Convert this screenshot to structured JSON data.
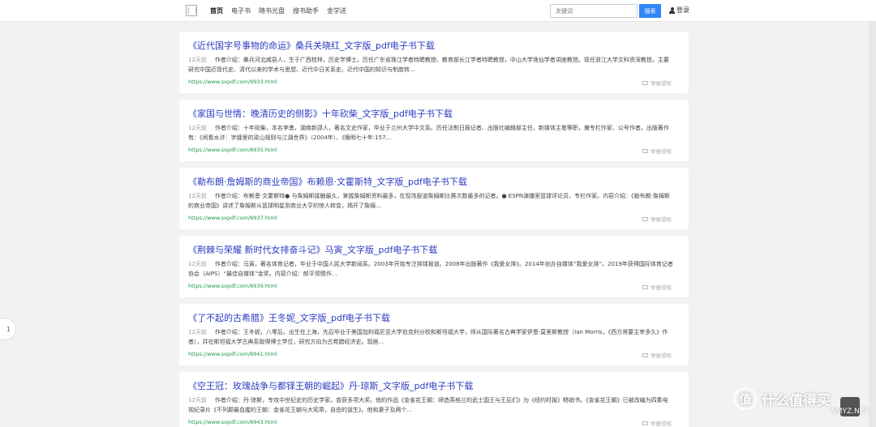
{
  "header": {
    "nav": [
      "首页",
      "电子书",
      "随书光盘",
      "搜书助手",
      "金学送"
    ],
    "search_placeholder": "关键词",
    "search_button": "搜索",
    "login": "登录"
  },
  "results": [
    {
      "title": "《近代国字号事物的命运》桑兵关晓红_文字版_pdf电子书下载",
      "time": "12天前",
      "desc": "作者介绍：桑兵河北威县人，生于广西桂林，历史学博士。历任广东省珠江学者特聘教授、教育部长江学者特聘教授，中山大学逸仙学者讲座教授。现任浙江大学文科资深教授。主要研究中国近现代史、清代以来的学术与思想、近代中日关系史、近代中国的知识与制度转...",
      "url": "https://www.sxpdf.com/8933.html",
      "report": "举报侵权"
    },
    {
      "title": "《家国与世情：晚清历史的侧影》十年砍柴_文字版_pdf电子书下载",
      "time": "12天前",
      "desc": "作者介绍：十年砍柴，本名李勇，湖南新邵人，著名文史作家，毕业于兰州大学中文系。历任法制日报记者、出版社编辑部主任、新媒体主笔等职，兼专栏作家、公号作者。出版著作有：《闲看水浒：字缝里的梁山规则与江湖世界》（2004年）、《晚明七十年:157...",
      "url": "https://www.sxpdf.com/8935.html",
      "report": "举报侵权"
    },
    {
      "title": "《勒布朗·詹姆斯的商业帝国》布赖恩·文霍斯特_文字版_pdf电子书下载",
      "time": "12天前",
      "desc": "作者介绍：布赖恩·文霍斯特● 与詹姆斯接触最久，掌握詹姆斯资料最多，在现场报道詹姆斯比赛次数最多的记者。● ESPN演播室篮球评论员、专栏作家。内容介绍：《勒布朗·詹姆斯的商业帝国》讲述了詹姆斯从篮球明星到商业大亨的惊人转变，揭开了詹姆...",
      "url": "https://www.sxpdf.com/8937.html",
      "report": "举报侵权"
    },
    {
      "title": "《荆棘与荣耀 新时代女排奋斗记》马寅_文字版_pdf电子书下载",
      "time": "12天前",
      "desc": "作者介绍：马寅，著名体育记者，毕业于中国人民大学新闻系。2003年开始专注排球报道。2008年出版著作《我爱女排》。2014年创办自媒体“我爱女排”。2019年获得国际体育记者协会（AIPS）“最佳自媒体”金奖。内容介绍：郎平领情作...",
      "url": "https://www.sxpdf.com/8939.html",
      "report": "举报侵权"
    },
    {
      "title": "《了不起的古希腊》王冬妮_文字版_pdf电子书下载",
      "time": "12天前",
      "desc": "作者介绍：王冬妮，八零后，出生在上海，先后毕业于美国加利福尼亚大学伯克利分校和斯坦福大学，师从国际著名古典学家伊恩·莫里斯教授（Ian Morris，《西方将要主宰多久》作者），并在斯坦福大学古典系取得博士学位，研究方向为古希腊经济史。现居...",
      "url": "https://www.sxpdf.com/8941.html",
      "report": "举报侵权"
    },
    {
      "title": "《空王冠：玫瑰战争与都铎王朝的崛起》丹·琼斯_文字版_pdf电子书下载",
      "time": "12天前",
      "desc": "作者介绍：丹·琼斯，专攻中世纪史的历史学家，曾获多项大奖。他的作品《金雀花王朝：缔造英格兰的武士国王与王后们》为《纽约时报》畅销书。《金雀花王朝》已被改编为四集电视纪录片《不列颠最血腥的王朝：金雀花王朝与大宪章，自由的诞生》。他和妻子及两个...",
      "url": "https://www.sxpdf.com/8943.html",
      "report": "举报侵权"
    }
  ],
  "page_indicator": "1",
  "watermark": {
    "brand": "什么值得买",
    "logo_glyph": "值",
    "sub": "SMYZ.NET"
  }
}
